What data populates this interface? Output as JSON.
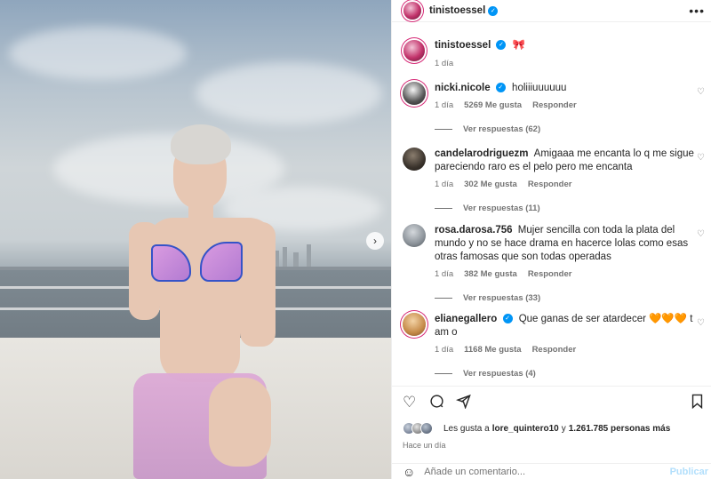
{
  "post": {
    "author": "tinistoessel",
    "caption_emoji": "🎀",
    "caption_time": "1 día"
  },
  "icons": {
    "verified": "checkmark-badge-icon",
    "more": "more-horizontal-icon",
    "next": "chevron-right-icon",
    "heart": "heart-outline-icon",
    "comment": "comment-bubble-icon",
    "share": "paper-plane-icon",
    "save": "bookmark-outline-icon",
    "emoji": "smiley-face-icon"
  },
  "comments": [
    {
      "user": "nicki.nicole",
      "verified": true,
      "text": "holiiiuuuuuu",
      "time": "1 día",
      "likes": "5269 Me gusta",
      "reply": "Responder",
      "replies": "Ver respuestas (62)"
    },
    {
      "user": "candelarodriguezm",
      "verified": false,
      "text": "Amigaaa me encanta lo q me sigue pareciendo raro es el pelo pero me encanta",
      "time": "1 día",
      "likes": "302 Me gusta",
      "reply": "Responder",
      "replies": "Ver respuestas (11)"
    },
    {
      "user": "rosa.darosa.756",
      "verified": false,
      "text": "Mujer sencilla con toda la plata del mundo y no se hace drama en hacerce lolas como esas otras famosas que son todas operadas",
      "time": "1 día",
      "likes": "382 Me gusta",
      "reply": "Responder",
      "replies": "Ver respuestas (33)"
    },
    {
      "user": "elianegallero",
      "verified": true,
      "text": "Que ganas de ser atardecer 🧡🧡🧡 t am o",
      "time": "1 día",
      "likes": "1168 Me gusta",
      "reply": "Responder",
      "replies": "Ver respuestas (4)"
    }
  ],
  "likes": {
    "prefix": "Les gusta a",
    "user": "lore_quintero10",
    "connector": "y",
    "count": "1.261.785 personas más"
  },
  "timestamp": "Hace un día",
  "add_comment": {
    "placeholder": "Añade un comentario...",
    "post_label": "Publicar"
  },
  "colors": {
    "brand_blue": "#0095f6",
    "text": "#262626",
    "secondary": "#737373"
  }
}
